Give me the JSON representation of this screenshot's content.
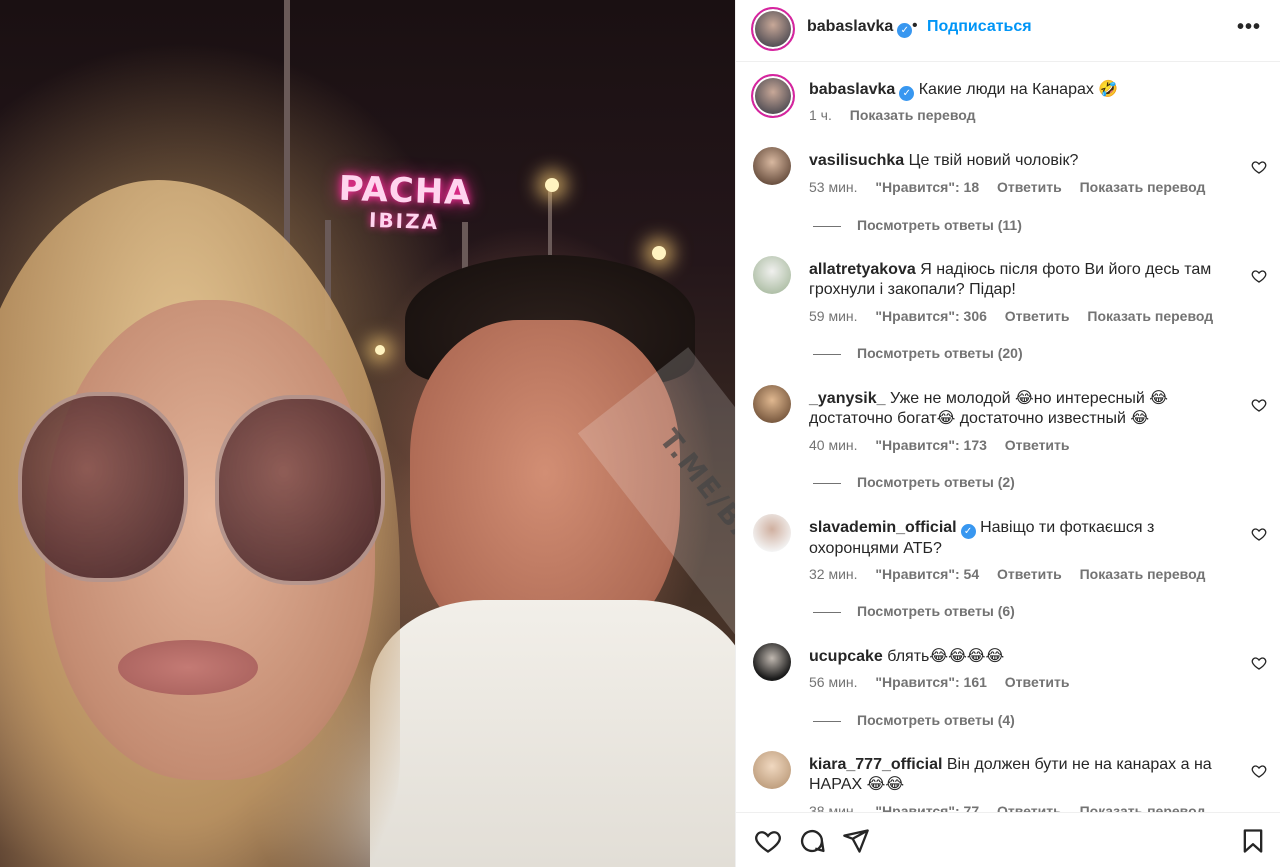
{
  "post": {
    "image_sign_top": "PACHA",
    "image_sign_bottom": "IBIZA",
    "watermark": "T.ME/BANKI.OIL"
  },
  "header": {
    "username": "babaslavka",
    "separator": "•",
    "follow_label": "Подписаться",
    "more_label": "•••"
  },
  "caption": {
    "username": "babaslavka",
    "text": "Какие люди на Канарах 🤣",
    "time": "1 ч.",
    "translate": "Показать перевод"
  },
  "comments": [
    {
      "username": "vasilisuchka",
      "text": "Це твій новий чоловік?",
      "time": "53 мин.",
      "likes": "\"Нравится\": 18",
      "reply": "Ответить",
      "translate": "Показать перевод",
      "replies": "Посмотреть ответы (11)"
    },
    {
      "username": "allatretyakova",
      "text": "Я надіюсь після фото Ви його десь там грохнули і закопали? Підар!",
      "time": "59 мин.",
      "likes": "\"Нравится\": 306",
      "reply": "Ответить",
      "translate": "Показать перевод",
      "replies": "Посмотреть ответы (20)"
    },
    {
      "username": "_yanysik_",
      "text": "Уже не молодой 😂но интересный 😂 достаточно богат😂 достаточно известный 😂",
      "time": "40 мин.",
      "likes": "\"Нравится\": 173",
      "reply": "Ответить",
      "translate": "",
      "replies": "Посмотреть ответы (2)"
    },
    {
      "username": "slavademin_official",
      "text": "Навіщо ти фоткаєшся з охоронцями АТБ?",
      "time": "32 мин.",
      "likes": "\"Нравится\": 54",
      "reply": "Ответить",
      "translate": "Показать перевод",
      "replies": "Посмотреть ответы (6)"
    },
    {
      "username": "ucupcake",
      "text": "блять😂😂😂😂",
      "time": "56 мин.",
      "likes": "\"Нравится\": 161",
      "reply": "Ответить",
      "translate": "",
      "replies": "Посмотреть ответы (4)"
    },
    {
      "username": "kiara_777_official",
      "text": "Він должен бути не на канарах а на НАРАХ 😂😂",
      "time": "38 мин.",
      "likes": "\"Нравится\": 77",
      "reply": "Ответить",
      "translate": "Показать перевод",
      "replies": ""
    }
  ],
  "icons": {
    "like": "heart-icon",
    "comment": "comment-icon",
    "share": "share-icon",
    "save": "bookmark-icon",
    "verified": "verified-icon"
  },
  "colors": {
    "accent": "#0095f6",
    "verified": "#3897f0",
    "secondary_text": "#737373"
  }
}
